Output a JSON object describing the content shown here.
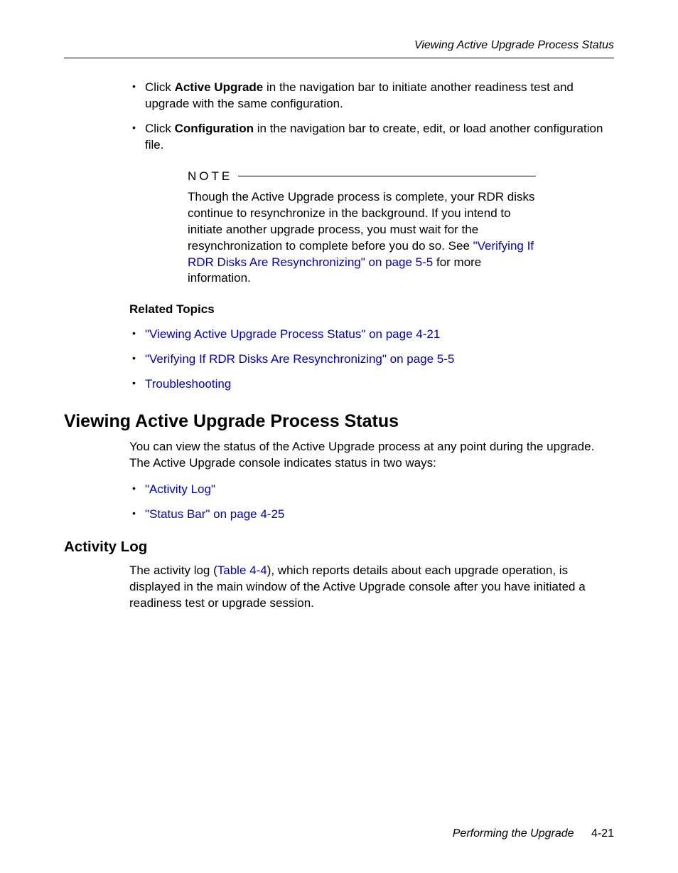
{
  "header": {
    "running_title": "Viewing Active Upgrade Process Status"
  },
  "bullets_top": {
    "item1": {
      "prefix": "Click ",
      "bold": "Active Upgrade",
      "suffix": " in the navigation bar to initiate another readiness test and upgrade with the same configuration."
    },
    "item2": {
      "prefix": "Click ",
      "bold": "Configuration",
      "suffix": " in the navigation bar to create, edit, or load another configuration file."
    }
  },
  "note": {
    "label": "NOTE",
    "body_prefix": "Though the Active Upgrade process is complete, your RDR disks continue to resynchronize in the background. If you intend to initiate another upgrade process, you must wait for the resynchronization to complete before you do so. See ",
    "link": "\"Verifying If RDR Disks Are Resynchronizing\" on page 5-5",
    "body_suffix": " for more information."
  },
  "related_topics": {
    "heading": "Related Topics",
    "items": {
      "a": "\"Viewing Active Upgrade Process Status\" on page 4-21",
      "b": "\"Verifying If RDR Disks Are Resynchronizing\" on page 5-5",
      "c": "Troubleshooting"
    }
  },
  "section": {
    "heading": "Viewing Active Upgrade Process Status",
    "intro": "You can view the status of the Active Upgrade process at any point during the upgrade. The Active Upgrade console indicates status in two ways:",
    "items": {
      "a": "\"Activity Log\"",
      "b": "\"Status Bar\" on page 4-25"
    }
  },
  "subsection": {
    "heading": "Activity Log",
    "body_prefix": "The activity log (",
    "link": "Table 4-4",
    "body_suffix": "), which reports details about each upgrade operation, is displayed in the main window of the Active Upgrade console after you have initiated a readiness test or upgrade session."
  },
  "footer": {
    "chapter": "Performing the Upgrade",
    "page": "4-21"
  }
}
